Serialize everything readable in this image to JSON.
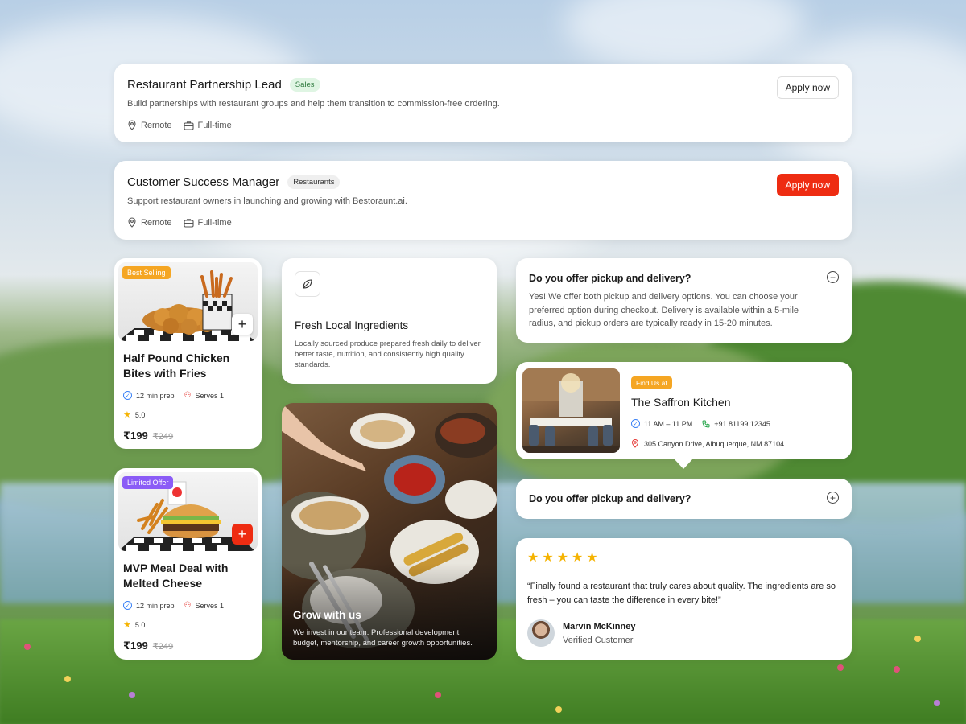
{
  "jobs": [
    {
      "title": "Restaurant Partnership Lead",
      "tag": "Sales",
      "description": "Build partnerships with restaurant groups and help them transition to commission-free ordering.",
      "location": "Remote",
      "type": "Full-time",
      "button": "Apply now"
    },
    {
      "title": "Customer Success Manager",
      "tag": "Restaurants",
      "description": "Support restaurant owners in launching and growing with Bestoraunt.ai.",
      "location": "Remote",
      "type": "Full-time",
      "button": "Apply now"
    }
  ],
  "food": [
    {
      "badge": "Best Selling",
      "title": "Half Pound Chicken Bites with Fries",
      "prep": "12 min prep",
      "serves": "Serves 1",
      "rating": "5.0",
      "price": "₹199",
      "old_price": "₹249",
      "add_icon": "plus-icon"
    },
    {
      "badge": "Limited Offer",
      "title": "MVP Meal Deal with Melted Cheese",
      "prep": "12 min prep",
      "serves": "Serves 1",
      "rating": "5.0",
      "price": "₹199",
      "old_price": "₹249",
      "add_icon": "plus-icon"
    }
  ],
  "fresh": {
    "icon": "leaf-icon",
    "title": "Fresh Local Ingredients",
    "description": "Locally sourced produce prepared fresh daily to deliver better taste, nutrition, and consistently high quality standards."
  },
  "grow": {
    "title": "Grow with us",
    "description": "We invest in our team. Professional development budget, mentorship, and career growth opportunities."
  },
  "faq": [
    {
      "question": "Do you offer pickup and delivery?",
      "answer": "Yes! We offer both pickup and delivery options. You can choose your preferred option during checkout. Delivery is available within a 5-mile radius, and pickup orders are typically ready in 15-20 minutes.",
      "toggle": "−"
    },
    {
      "question": "Do you offer pickup and delivery?",
      "toggle": "+"
    }
  ],
  "restaurant": {
    "badge": "Find Us at",
    "name": "The Saffron Kitchen",
    "hours": "11 AM – 11 PM",
    "phone": "+91 81199 12345",
    "address": "305 Canyon Drive, Albuquerque, NM 87104"
  },
  "review": {
    "stars": 5,
    "quote": "“Finally found a restaurant that truly cares about quality. The ingredients are so fresh – you can taste the difference in every bite!”",
    "name": "Marvin McKinney",
    "role": "Verified Customer"
  },
  "colors": {
    "accent": "#ee2c12",
    "star": "#f5b301",
    "badge_orange": "#f5a623",
    "badge_purple": "#8b5cf6"
  }
}
